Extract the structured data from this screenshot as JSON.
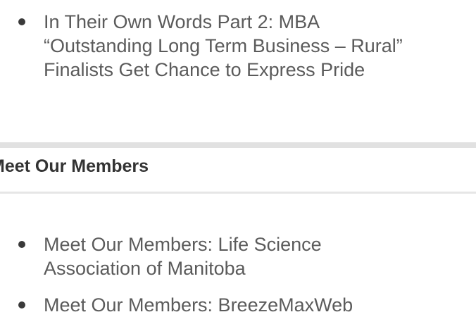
{
  "news": {
    "items": [
      {
        "line1": "In Their Own Words Part 2: MBA",
        "line2": "“Outstanding Long Term Business – Rural”",
        "line3": "Finalists Get Chance to Express Pride"
      }
    ]
  },
  "members_section": {
    "title": "Meet Our Members",
    "items": [
      {
        "line1": "Meet Our Members: Life Science",
        "line2": "Association of Manitoba"
      },
      {
        "line1": "Meet Our Members: BreezeMaxWeb"
      }
    ]
  }
}
